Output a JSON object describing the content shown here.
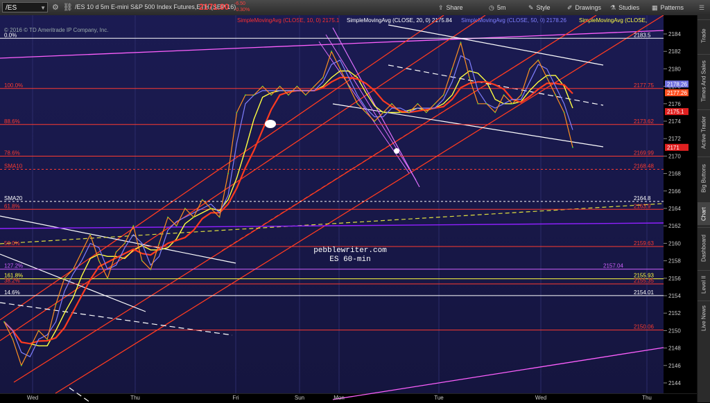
{
  "toolbar": {
    "symbol": "/ES",
    "title": "/ES 10 d 5m  E-mini S&P 500 Index Futures,ETH (SEP 16)",
    "quote_line": "D: 8/10/16 8:20 AM  O: 2171.25  H: 2171.75  L: 2170.75  C: 2171",
    "last_price": "2171.00",
    "change": "-6.50",
    "change_pct": "-0.30%",
    "buttons": [
      "Share",
      "5m",
      "Style",
      "Drawings",
      "Studies",
      "Patterns"
    ]
  },
  "studies": [
    {
      "label": "SimpleMovingAvg (CLOSE, 10, 0)",
      "value": "2175.1",
      "color": "#ff3030"
    },
    {
      "label": "SimpleMovingAvg (CLOSE, 20, 0)",
      "value": "2175.84",
      "color": "#ffffff"
    },
    {
      "label": "SimpleMovingAvg (CLOSE, 50, 0)",
      "value": "2178.26",
      "color": "#8080ff"
    },
    {
      "label": "SimpleMovingAvg (CLOSE,",
      "value": "",
      "color": "#ffff40"
    }
  ],
  "copyright": "© 2016 © TD Ameritrade IP Company, Inc.",
  "watermark": {
    "line1": "pebblewriter.com",
    "line2": "ES 60-min"
  },
  "y_ticks": [
    "2184",
    "2182",
    "2180",
    "2178",
    "2176",
    "2174",
    "2172",
    "2170",
    "2168",
    "2166",
    "2164",
    "2162",
    "2160",
    "2158",
    "2156",
    "2154",
    "2152",
    "2150",
    "2148",
    "2146",
    "2144"
  ],
  "x_labels": [
    "Wed",
    "Thu",
    "Fri",
    "Sun",
    "Mon",
    "Tue",
    "Wed",
    "Thu"
  ],
  "fib_levels": [
    {
      "pct": "0.0%",
      "value": "2183.5",
      "color": "#ffffff"
    },
    {
      "pct": "100.0%",
      "value": "2177.75",
      "color": "#ff3b30"
    },
    {
      "pct": "88.6%",
      "value": "2173.62",
      "color": "#ff3b30"
    },
    {
      "pct": "78.6%",
      "value": "2169.99",
      "color": "#ff3b30"
    },
    {
      "pct": "SMA10",
      "value": "2168.48",
      "color": "#ff3b30"
    },
    {
      "pct": "SMA20",
      "value": "2164.8",
      "color": "#ffffff"
    },
    {
      "pct": "61.8%",
      "value": "2163.9",
      "color": "#ff3b30"
    },
    {
      "pct": "50.0%",
      "value": "2159.63",
      "color": "#ff3b30"
    },
    {
      "pct": "127.2%",
      "value": "2157.04",
      "color": "#d060ff"
    },
    {
      "pct": "161.8%",
      "value": "2155.93",
      "color": "#ffff40"
    },
    {
      "pct": "38.2%",
      "value": "2155.35",
      "color": "#ff3b30"
    },
    {
      "pct": "14.6%",
      "value": "2154.01",
      "color": "#ffffff"
    },
    {
      "pct": "",
      "value": "2150.06",
      "color": "#ff3b30"
    }
  ],
  "axis_badges": [
    {
      "value": "2178.26",
      "color": "#7070e0"
    },
    {
      "value": "2177.26",
      "color": "#ff5020"
    },
    {
      "value": "2175.1",
      "color": "#e02020"
    },
    {
      "value": "2171",
      "color": "#e02020"
    }
  ],
  "side_tabs": [
    "Trade",
    "Times And Sales",
    "Active Trader",
    "Big Buttons",
    "Chart",
    "Dashboard",
    "Level II",
    "Live News"
  ],
  "active_tab": "Chart",
  "chart_data": {
    "type": "line",
    "ylim": [
      2143.5,
      2185
    ],
    "series": [
      {
        "name": "",
        "values": [
          2151,
          2149,
          2146,
          2148,
          2150,
          2149,
          2153,
          2156,
          2157,
          2159,
          2161,
          2158,
          2156,
          2159,
          2160,
          2162,
          2158,
          2157,
          2160,
          2163,
          2162,
          2164,
          2163,
          2165,
          2164,
          2163,
          2168,
          2175,
          2177,
          2177,
          2178,
          2177,
          2178,
          2177,
          2178,
          2177,
          2178,
          2179,
          2182,
          2180,
          2178,
          2176,
          2175,
          2174,
          2175,
          2176,
          2175,
          2175,
          2176,
          2175,
          2176,
          2177,
          2180,
          2183,
          2179,
          2176,
          2176,
          2175,
          2177,
          2176,
          2177,
          2180,
          2181,
          2179,
          2177,
          2175,
          2171
        ]
      }
    ]
  }
}
